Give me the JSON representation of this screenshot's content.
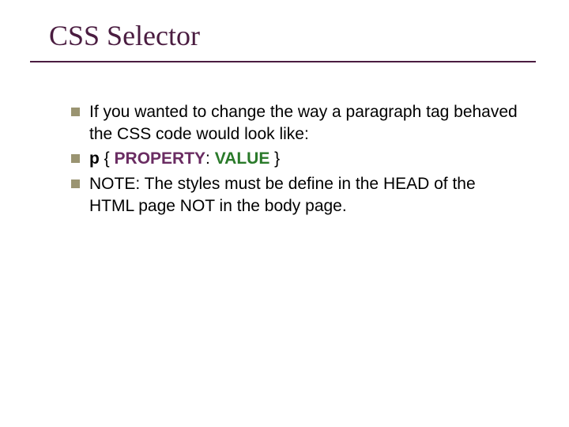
{
  "title": "CSS Selector",
  "bullets": {
    "b1": "If you wanted to change the way a paragraph tag behaved the CSS code would look like:",
    "b2_selector": "p",
    "b2_open": " { ",
    "b2_property": "PROPERTY",
    "b2_colon": ": ",
    "b2_value": "VALUE",
    "b2_close": " }",
    "b3": "NOTE: The styles must be define in the HEAD of the HTML page NOT in the body page."
  }
}
